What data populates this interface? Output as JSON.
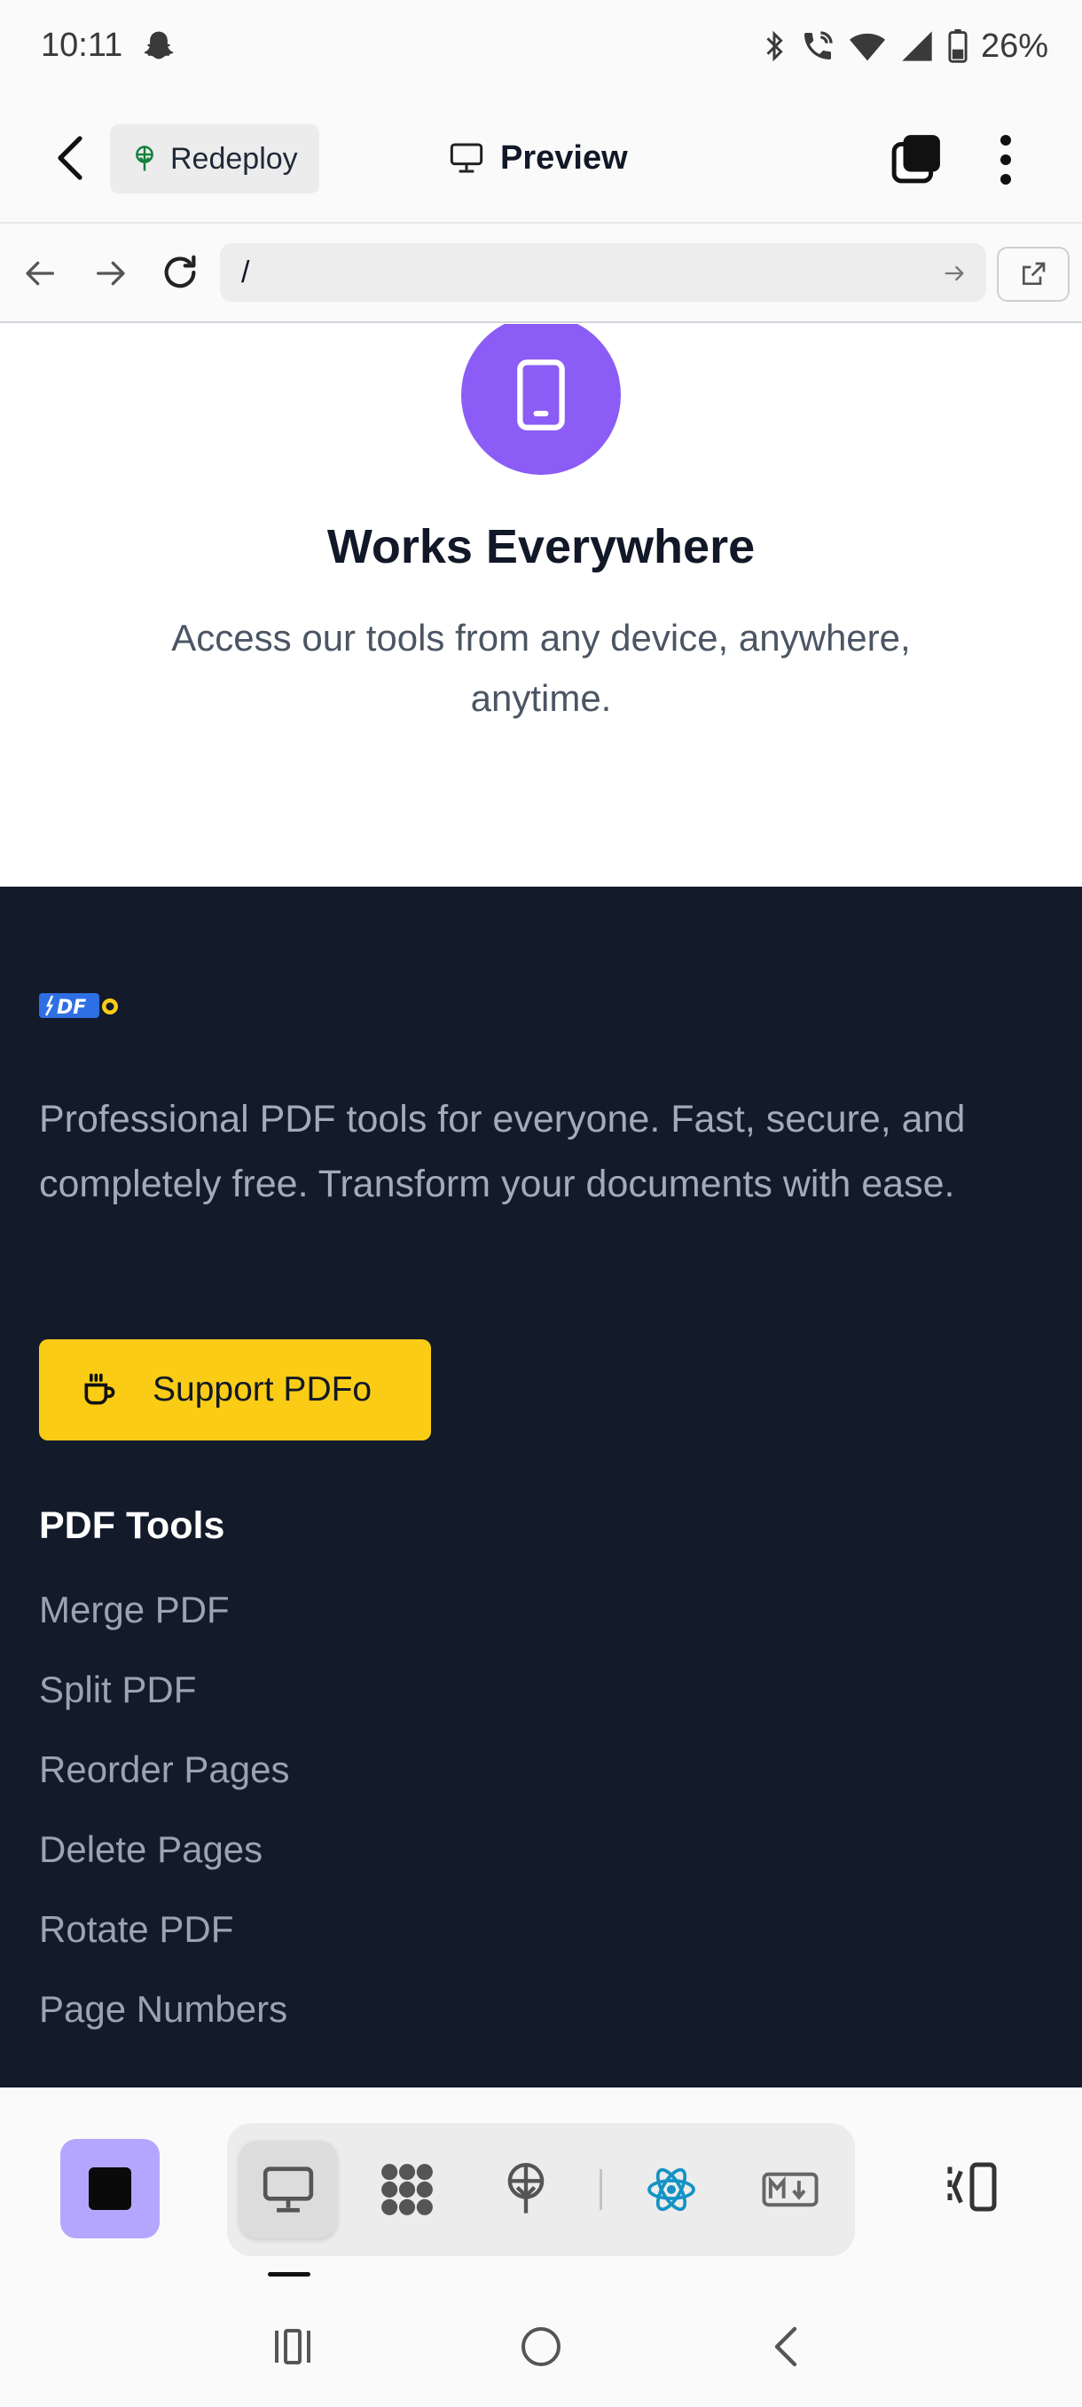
{
  "status_bar": {
    "time": "10:11",
    "battery": "26%",
    "icons": [
      "snapchat-icon",
      "bluetooth-icon",
      "wifi-calling-icon",
      "wifi-icon",
      "signal-icon",
      "battery-icon"
    ]
  },
  "header": {
    "redeploy_label": "Redeploy",
    "preview_label": "Preview"
  },
  "url_bar": {
    "url": "/"
  },
  "feature": {
    "title": "Works Everywhere",
    "description": "Access our tools from any device, anywhere, anytime."
  },
  "footer": {
    "description": "Professional PDF tools for everyone. Fast, secure, and completely free. Transform your documents with ease.",
    "support_label": "Support PDFo",
    "tools_heading": "PDF Tools",
    "tools": [
      "Merge PDF",
      "Split PDF",
      "Reorder Pages",
      "Delete Pages",
      "Rotate PDF",
      "Page Numbers"
    ]
  },
  "colors": {
    "accent_purple": "#8b5cf6",
    "footer_bg": "#131a2a",
    "support_yellow": "#facc15",
    "stop_lavender": "#b4a6ff",
    "react_blue": "#1493c4"
  }
}
